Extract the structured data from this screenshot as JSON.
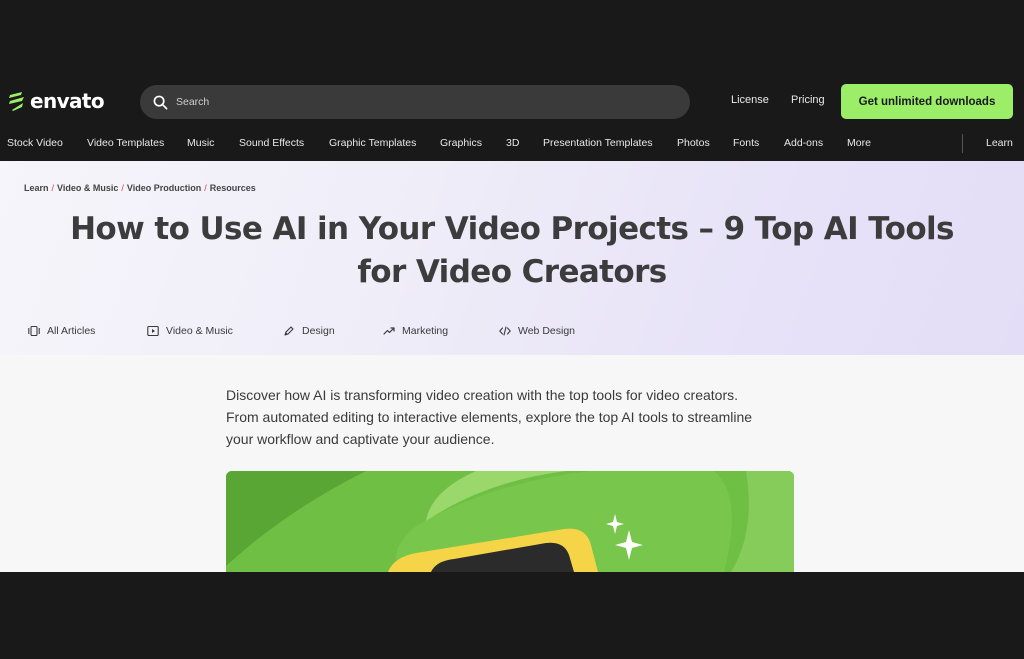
{
  "brand": {
    "name": "envato",
    "accent": "#9cee69"
  },
  "search": {
    "placeholder": "Search",
    "icon": "search-icon"
  },
  "top_links": [
    "License",
    "Pricing"
  ],
  "cta": "Get unlimited downloads",
  "categories": [
    "Stock Video",
    "Video Templates",
    "Music",
    "Sound Effects",
    "Graphic Templates",
    "Graphics",
    "3D",
    "Presentation Templates",
    "Photos",
    "Fonts",
    "Add-ons",
    "More"
  ],
  "learn_link": "Learn",
  "breadcrumb": [
    "Learn",
    "Video & Music",
    "Video Production",
    "Resources"
  ],
  "breadcrumb_separator": "/",
  "title_lines": [
    "How to Use AI in Your Video Projects – 9 Top AI Tools",
    "for Video Creators"
  ],
  "article_nav": [
    {
      "label": "All Articles",
      "icon": "articles-icon"
    },
    {
      "label": "Video & Music",
      "icon": "video-play-icon"
    },
    {
      "label": "Design",
      "icon": "pen-icon"
    },
    {
      "label": "Marketing",
      "icon": "trend-up-icon"
    },
    {
      "label": "Web Design",
      "icon": "code-icon"
    }
  ],
  "intro_lines": [
    "Discover how AI is transforming video creation with the top tools for video creators.",
    "From automated editing to interactive elements, explore the top AI tools to streamline",
    "your workflow and captivate your audience."
  ],
  "hero_image": {
    "description_icon": "sparkles-icon",
    "colors": [
      "#6fbf45",
      "#f5d547",
      "#2b2b2b"
    ]
  }
}
